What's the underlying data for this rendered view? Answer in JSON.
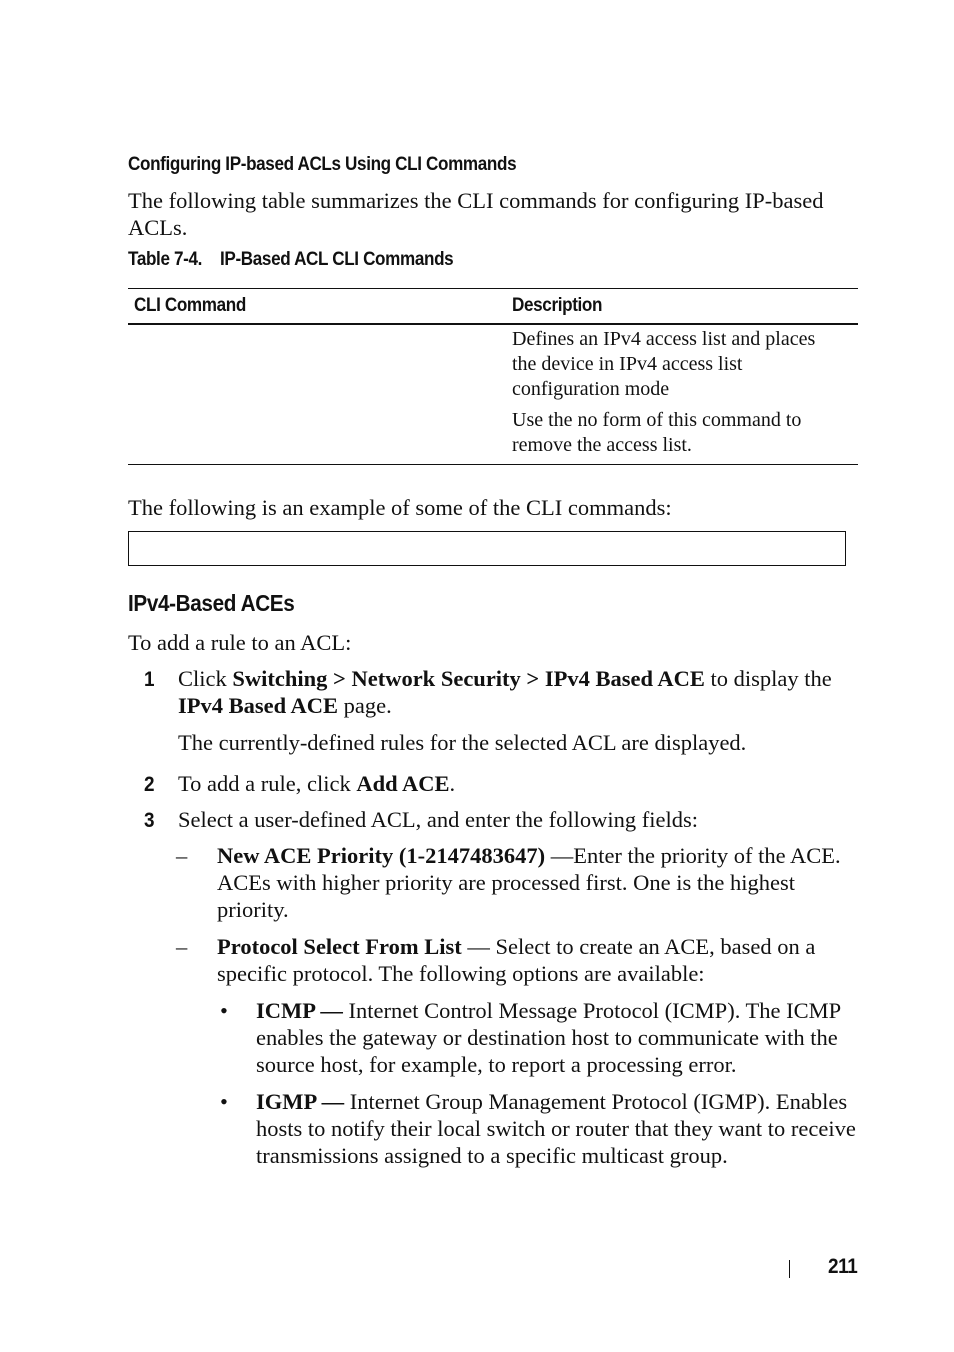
{
  "section": {
    "heading": "Configuring IP-based ACLs Using CLI Commands",
    "intro": "The following table summarizes the CLI commands for configuring IP-based ACLs."
  },
  "table": {
    "caption_number": "Table 7-4.",
    "caption_title": "IP-Based ACL CLI Commands",
    "headers": [
      "CLI Command",
      "Description"
    ],
    "rows": [
      {
        "command": "",
        "description": [
          "Defines an IPv4 access list and places the device in IPv4 access list configuration mode",
          "Use the no form of this command to remove the access list."
        ]
      }
    ]
  },
  "example": {
    "intro": "The following is an example of some of the CLI commands:",
    "code": ""
  },
  "subsection": {
    "heading": "IPv4-Based ACEs",
    "lead": "To add a rule to an ACL:"
  },
  "steps": [
    {
      "number": "1",
      "parts": [
        {
          "text": "Click ",
          "bold": false
        },
        {
          "text": "Switching > Network Security > IPv4 Based ACE",
          "bold": true
        },
        {
          "text": " to display the ",
          "bold": false
        },
        {
          "text": "IPv4 Based ACE",
          "bold": true
        },
        {
          "text": " page.",
          "bold": false
        }
      ],
      "note": "The currently-defined rules for the selected ACL are displayed."
    },
    {
      "number": "2",
      "parts": [
        {
          "text": "To add a rule, click ",
          "bold": false
        },
        {
          "text": "Add ACE",
          "bold": true
        },
        {
          "text": ".",
          "bold": false
        }
      ]
    },
    {
      "number": "3",
      "parts": [
        {
          "text": "Select a user-defined ACL, and enter the following fields:",
          "bold": false
        }
      ]
    }
  ],
  "fields": [
    {
      "marker": "–",
      "term": "New ACE Priority (1-2147483647)",
      "separator": " —",
      "text": "Enter the priority of the ACE. ACEs with higher priority are processed first. One is the highest priority."
    },
    {
      "marker": "–",
      "term": "Protocol Select From List",
      "separator": " — ",
      "text": "Select to create an ACE, based on a specific protocol. The following options are available:"
    }
  ],
  "protocols": [
    {
      "marker": "•",
      "term": "ICMP —",
      "text": " Internet Control Message Protocol (ICMP). The ICMP enables the gateway or destination host to communicate with the source host, for example, to report a processing error."
    },
    {
      "marker": "•",
      "term": "IGMP —",
      "text": " Internet Group Management Protocol (IGMP). Enables hosts to notify their local switch or router that they want to receive transmissions assigned to a specific multicast group."
    }
  ],
  "footer": {
    "page_number": "211"
  }
}
